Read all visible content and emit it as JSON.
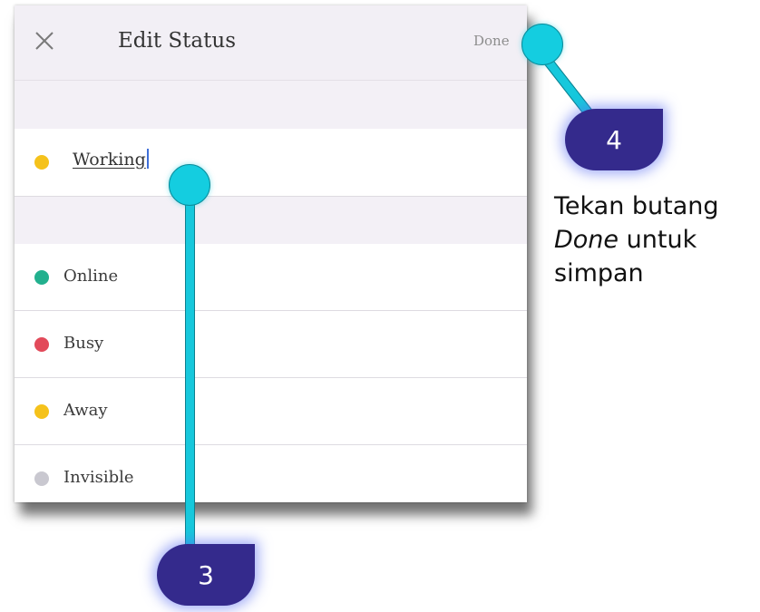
{
  "header": {
    "title": "Edit Status",
    "done_label": "Done"
  },
  "status_input": {
    "value": "Working",
    "dot_color": "#F5C21B"
  },
  "options": [
    {
      "label": "Online",
      "dot_color": "#22B08E"
    },
    {
      "label": "Busy",
      "dot_color": "#E24A5A"
    },
    {
      "label": "Away",
      "dot_color": "#F5C21B"
    },
    {
      "label": "Invisible",
      "dot_color": "#C9C8D0"
    }
  ],
  "callouts": {
    "step_3": "3",
    "step_4": "4"
  },
  "caption": {
    "part1": "Tekan butang",
    "italic": "Done",
    "part2": "untuk",
    "part3": "simpan"
  }
}
